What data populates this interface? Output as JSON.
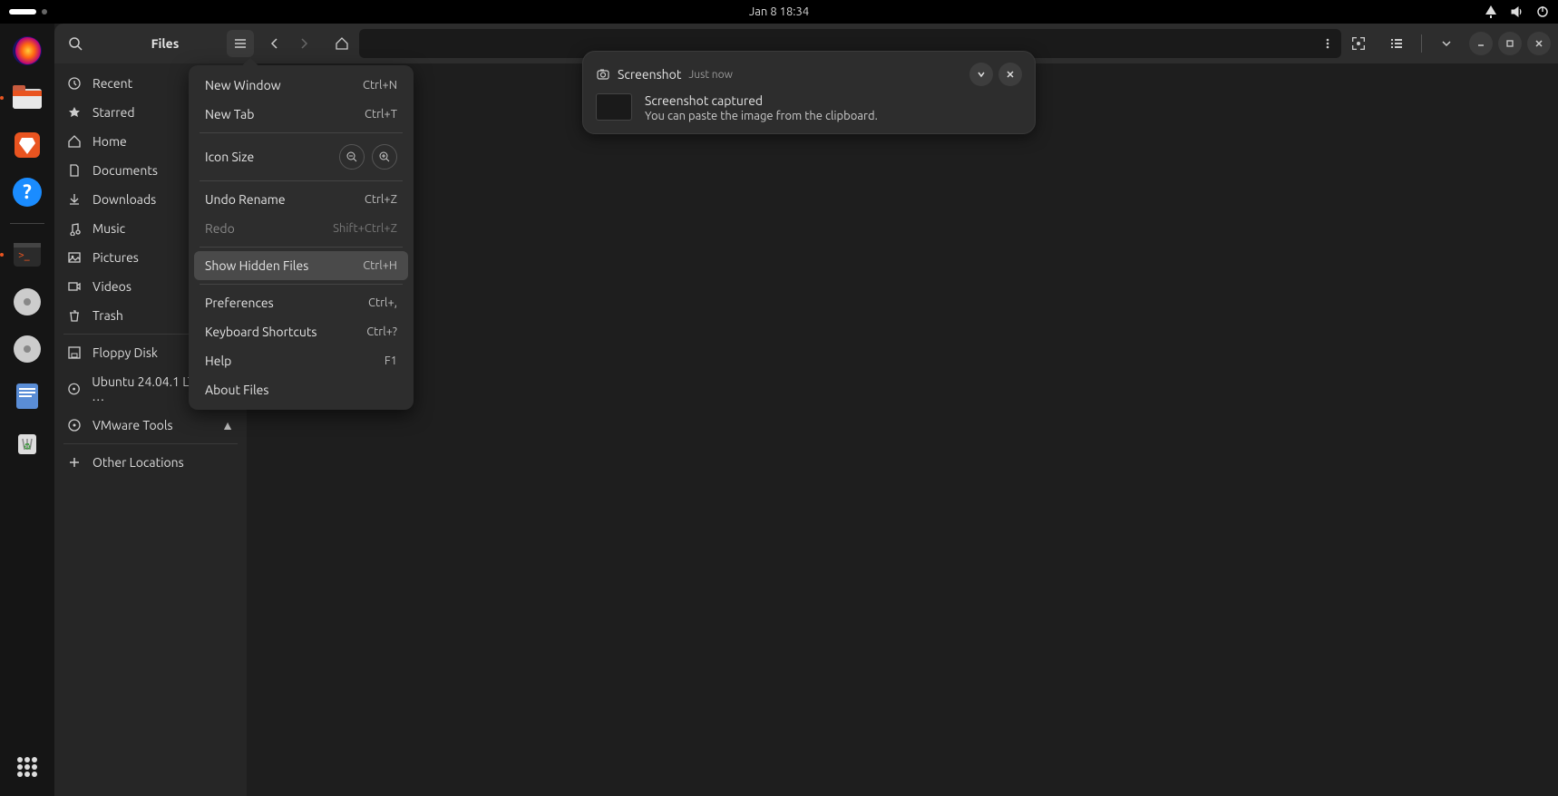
{
  "topbar": {
    "datetime": "Jan 8  18:34"
  },
  "dock": {
    "items": [
      {
        "name": "firefox"
      },
      {
        "name": "files",
        "active": true
      },
      {
        "name": "software"
      },
      {
        "name": "help"
      }
    ],
    "items2": [
      {
        "name": "terminal",
        "active": true
      },
      {
        "name": "disc1"
      },
      {
        "name": "disc2"
      },
      {
        "name": "text-editor"
      },
      {
        "name": "trash"
      }
    ],
    "apps": "show-apps"
  },
  "header": {
    "title": "Files"
  },
  "sidebar": {
    "items": [
      {
        "icon": "recent",
        "label": "Recent"
      },
      {
        "icon": "star",
        "label": "Starred"
      },
      {
        "icon": "home",
        "label": "Home"
      },
      {
        "icon": "documents",
        "label": "Documents"
      },
      {
        "icon": "downloads",
        "label": "Downloads"
      },
      {
        "icon": "music",
        "label": "Music"
      },
      {
        "icon": "pictures",
        "label": "Pictures"
      },
      {
        "icon": "videos",
        "label": "Videos"
      },
      {
        "icon": "trash",
        "label": "Trash"
      }
    ],
    "mounts": [
      {
        "icon": "floppy",
        "label": "Floppy Disk"
      },
      {
        "icon": "disc",
        "label": "Ubuntu 24.04.1 LTS …",
        "eject": true
      },
      {
        "icon": "disc",
        "label": "VMware Tools",
        "eject": true
      }
    ],
    "other": {
      "icon": "plus",
      "label": "Other Locations"
    }
  },
  "menu": {
    "new_window": {
      "label": "New Window",
      "shortcut": "Ctrl+N"
    },
    "new_tab": {
      "label": "New Tab",
      "shortcut": "Ctrl+T"
    },
    "icon_size": {
      "label": "Icon Size"
    },
    "undo": {
      "label": "Undo Rename",
      "shortcut": "Ctrl+Z"
    },
    "redo": {
      "label": "Redo",
      "shortcut": "Shift+Ctrl+Z",
      "disabled": true
    },
    "show_hidden": {
      "label": "Show Hidden Files",
      "shortcut": "Ctrl+H",
      "hover": true
    },
    "preferences": {
      "label": "Preferences",
      "shortcut": "Ctrl+,"
    },
    "shortcuts": {
      "label": "Keyboard Shortcuts",
      "shortcut": "Ctrl+?"
    },
    "help": {
      "label": "Help",
      "shortcut": "F1"
    },
    "about": {
      "label": "About Files"
    }
  },
  "notification": {
    "app": "Screenshot",
    "time": "Just now",
    "title": "Screenshot captured",
    "body": "You can paste the image from the clipboard."
  }
}
